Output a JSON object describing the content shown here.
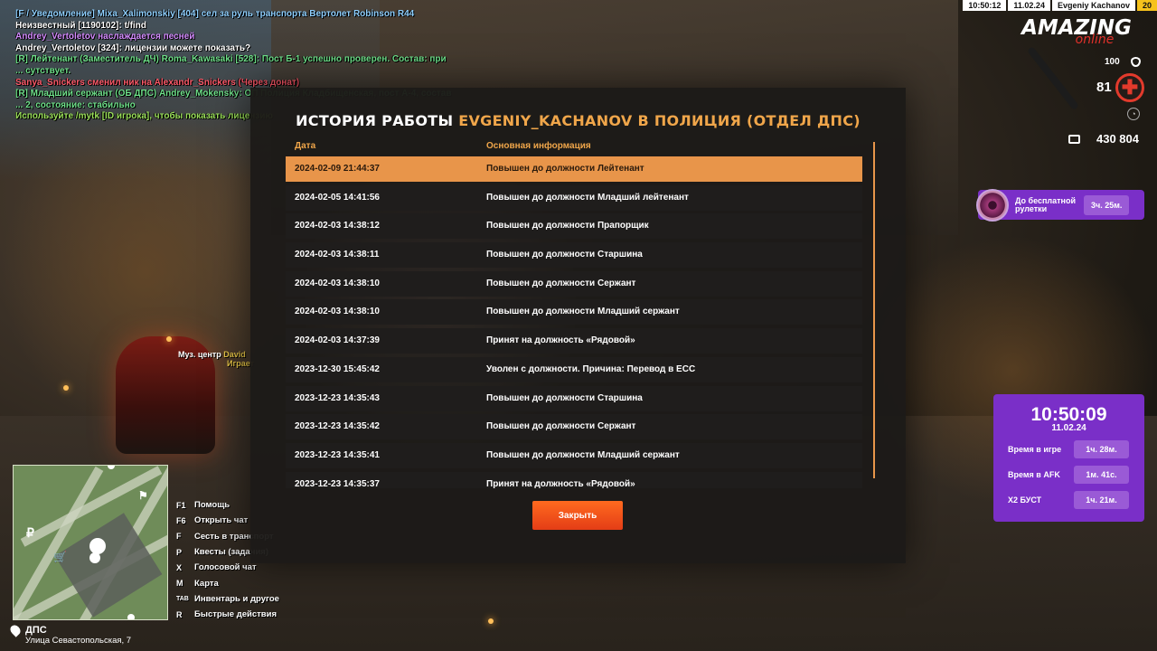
{
  "chat": [
    {
      "text": "[F / Уведомление] Mixa_Xalimonskiy [404] сел за руль транспорта Вертолет Robinson R44",
      "color": "#8fd0ff"
    },
    {
      "text": "Неизвестный [1190102]: t/find",
      "color": "#ffffff"
    },
    {
      "text": "Andrey_Vertoletov наслаждается песней",
      "color": "#d48cff"
    },
    {
      "text": "Andrey_Vertoletov [324]: лицензии можете показать?",
      "color": "#ffffff"
    },
    {
      "text": "[R] Лейтенант (Заместитель ДЧ) Roma_Kawasaki [528]: Пост Б-1 успешно проверен. Состав: при",
      "color": "#6fe08a"
    },
    {
      "text": "... сутствует.",
      "color": "#6fe08a"
    },
    {
      "text": "Sanya_Snickers сменил ник на Alexandr_Snickers (Через донат)",
      "color": "#ff5a6a"
    },
    {
      "text": "[R] Младший сержант (ОБ ДПС) Andrey_Mokensky: ОП Полиция Кладбищенская, пост А-4, состав",
      "color": "#6fe08a"
    },
    {
      "text": "... 2, состояние: стабильно",
      "color": "#6fe08a"
    },
    {
      "text": "Используйте /mytk [ID игрока], чтобы показать лицензию",
      "color": "#9be05a"
    }
  ],
  "topbar": {
    "time": "10:50:12",
    "date": "11.02.24",
    "player": "Evgeniy Kachanov",
    "level": "20"
  },
  "logo": {
    "main": "AMAZING",
    "sub": "online"
  },
  "hud": {
    "armor": "100",
    "hp": "81",
    "money": "430 804",
    "hp_icon": "cross-icon",
    "armor_icon": "shield-icon",
    "money_icon": "wallet-icon"
  },
  "roulette": {
    "label": "До бесплатной рулетки",
    "time": "3ч. 25м."
  },
  "timepanel": {
    "clock": "10:50:09",
    "date": "11.02.24",
    "rows": [
      {
        "label": "Время в игре",
        "value": "1ч. 28м."
      },
      {
        "label": "Время в AFK",
        "value": "1м. 41с."
      },
      {
        "label": "X2 БУСТ",
        "value": "1ч. 21м."
      }
    ]
  },
  "keys": [
    {
      "key": "F1",
      "label": "Помощь"
    },
    {
      "key": "F6",
      "label": "Открыть чат"
    },
    {
      "key": "F",
      "label": "Сесть в транспорт"
    },
    {
      "key": "P",
      "label": "Квесты (задания)"
    },
    {
      "key": "X",
      "label": "Голосовой чат"
    },
    {
      "key": "M",
      "label": "Карта"
    },
    {
      "key": "TAB",
      "label": "Инвентарь и другое"
    },
    {
      "key": "R",
      "label": "Быстрые действия"
    }
  ],
  "location": {
    "title": "ДПС",
    "street": "Улица Севастопольская, 7"
  },
  "music": {
    "label": "Муз. центр",
    "name": "David",
    "sub": "Играет"
  },
  "modal": {
    "title_prefix": "ИСТОРИЯ РАБОТЫ ",
    "title_name": "EVGENIY_KACHANOV В ПОЛИЦИЯ (ОТДЕЛ ДПС)",
    "col_date": "Дата",
    "col_info": "Основная информация",
    "rows": [
      {
        "date": "2024-02-09 21:44:37",
        "info": "Повышен до должности Лейтенант"
      },
      {
        "date": "2024-02-05 14:41:56",
        "info": "Повышен до должности Младший лейтенант"
      },
      {
        "date": "2024-02-03 14:38:12",
        "info": "Повышен до должности Прапорщик"
      },
      {
        "date": "2024-02-03 14:38:11",
        "info": "Повышен до должности Старшина"
      },
      {
        "date": "2024-02-03 14:38:10",
        "info": "Повышен до должности Сержант"
      },
      {
        "date": "2024-02-03 14:38:10",
        "info": "Повышен до должности Младший сержант"
      },
      {
        "date": "2024-02-03 14:37:39",
        "info": "Принят на должность «Рядовой»"
      },
      {
        "date": "2023-12-30 15:45:42",
        "info": "Уволен с должности. Причина: Перевод в ЕСС"
      },
      {
        "date": "2023-12-23 14:35:43",
        "info": "Повышен до должности Старшина"
      },
      {
        "date": "2023-12-23 14:35:42",
        "info": "Повышен до должности Сержант"
      },
      {
        "date": "2023-12-23 14:35:41",
        "info": "Повышен до должности Младший сержант"
      },
      {
        "date": "2023-12-23 14:35:37",
        "info": "Принят на должность «Рядовой»"
      }
    ],
    "close_label": "Закрыть"
  }
}
